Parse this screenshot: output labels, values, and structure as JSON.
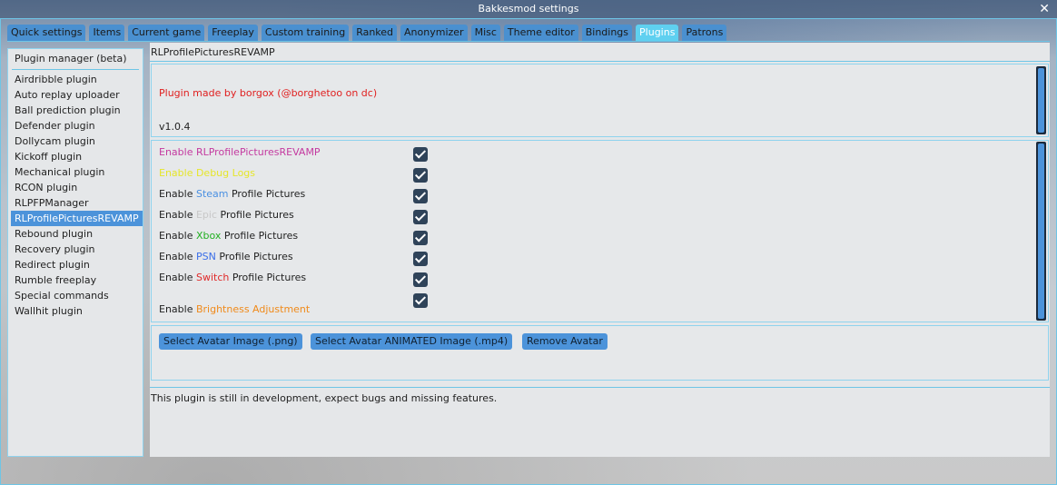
{
  "window": {
    "title": "Bakkesmod settings"
  },
  "tabs": [
    {
      "label": "Quick settings"
    },
    {
      "label": "Items"
    },
    {
      "label": "Current game"
    },
    {
      "label": "Freeplay"
    },
    {
      "label": "Custom training"
    },
    {
      "label": "Ranked"
    },
    {
      "label": "Anonymizer"
    },
    {
      "label": "Misc"
    },
    {
      "label": "Theme editor"
    },
    {
      "label": "Bindings"
    },
    {
      "label": "Plugins",
      "active": true
    },
    {
      "label": "Patrons"
    }
  ],
  "sidebar": {
    "title": "Plugin manager (beta)",
    "items": [
      "Airdribble plugin",
      "Auto replay uploader",
      "Ball prediction plugin",
      "Defender plugin",
      "Dollycam plugin",
      "Kickoff plugin",
      "Mechanical plugin",
      "RCON plugin",
      "RLPFPManager",
      "RLProfilePicturesREVAMP",
      "Rebound plugin",
      "Recovery plugin",
      "Redirect plugin",
      "Rumble freeplay",
      "Special commands",
      "Wallhit plugin"
    ],
    "selected": "RLProfilePicturesREVAMP"
  },
  "plugin": {
    "title": "RLProfilePicturesREVAMP",
    "credit": "Plugin made by borgox (@borghetoo on dc)",
    "version": "v1.0.4",
    "options": [
      {
        "prefix": "",
        "highlight": "Enable RLProfilePicturesREVAMP",
        "suffix": "",
        "color": "#c43aa0",
        "checked": true
      },
      {
        "prefix": "",
        "highlight": "Enable Debug Logs",
        "suffix": "",
        "color": "#e6e62a",
        "checked": true
      },
      {
        "prefix": "Enable ",
        "highlight": "Steam",
        "suffix": " Profile Pictures",
        "color": "#4a90e2",
        "checked": true
      },
      {
        "prefix": "Enable ",
        "highlight": "Epic",
        "suffix": " Profile Pictures",
        "color": "#c8c8c8",
        "checked": true
      },
      {
        "prefix": "Enable ",
        "highlight": "Xbox",
        "suffix": " Profile Pictures",
        "color": "#22b022",
        "checked": true
      },
      {
        "prefix": "Enable ",
        "highlight": "PSN",
        "suffix": " Profile Pictures",
        "color": "#3a6ee8",
        "checked": true
      },
      {
        "prefix": "Enable ",
        "highlight": "Switch",
        "suffix": " Profile Pictures",
        "color": "#e02a2a",
        "checked": true
      },
      {
        "prefix": "Enable ",
        "highlight": "Brightness Adjustment",
        "suffix": "",
        "color": "#f08a1a",
        "checked": true
      }
    ],
    "buttons": {
      "select_avatar": "Select Avatar Image (.png)",
      "select_animated": "Select Avatar ANIMATED Image (.mp4)",
      "remove_avatar": "Remove Avatar"
    },
    "note": "This plugin is still in development, expect bugs and missing features."
  },
  "colors": {
    "accent": "#4c93da",
    "border": "#6ec5e6",
    "active_tab": "#5fd0f0"
  }
}
